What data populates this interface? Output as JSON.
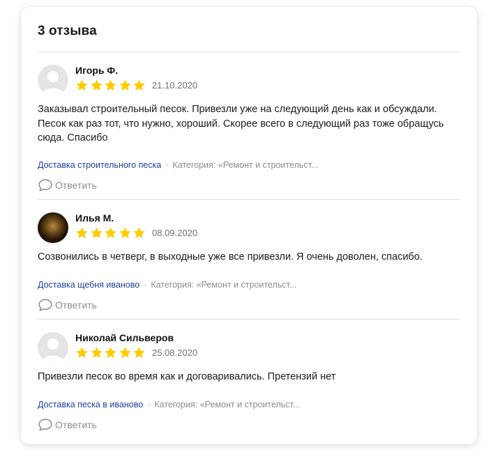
{
  "header": {
    "title": "3 отзыва"
  },
  "colors": {
    "star": "#ffcc00",
    "link": "#21409a",
    "muted": "#8c8c8c"
  },
  "reviews": [
    {
      "author": "Игорь Ф.",
      "rating": 5,
      "date": "21.10.2020",
      "avatar": "person-silhouette",
      "text": "Заказывал строительный песок. Привезли уже на следующий день как и обсуждали. Песок как раз тот, что нужно, хороший. Скорее всего в следующий раз тоже обращусь сюда. Спасибо",
      "service_link": "Доставка строительного песка",
      "category": "Категория: «Ремонт и строительст...",
      "reply_label": "Ответить"
    },
    {
      "author": "Илья М.",
      "rating": 5,
      "date": "08.09.2020",
      "avatar": "user-photo",
      "text": "Созвонились в четверг, в выходные уже все привезли. Я очень доволен, спасибо.",
      "service_link": "Доставка щебня иваново",
      "category": "Категория: «Ремонт и строительст...",
      "reply_label": "Ответить"
    },
    {
      "author": "Николай Сильверов",
      "rating": 5,
      "date": "25.08.2020",
      "avatar": "person-silhouette",
      "text": "Привезли песок во время как и договаривались. Претензий нет",
      "service_link": "Доставка песка в иваново",
      "category": "Категория: «Ремонт и строительст...",
      "reply_label": "Ответить"
    }
  ]
}
